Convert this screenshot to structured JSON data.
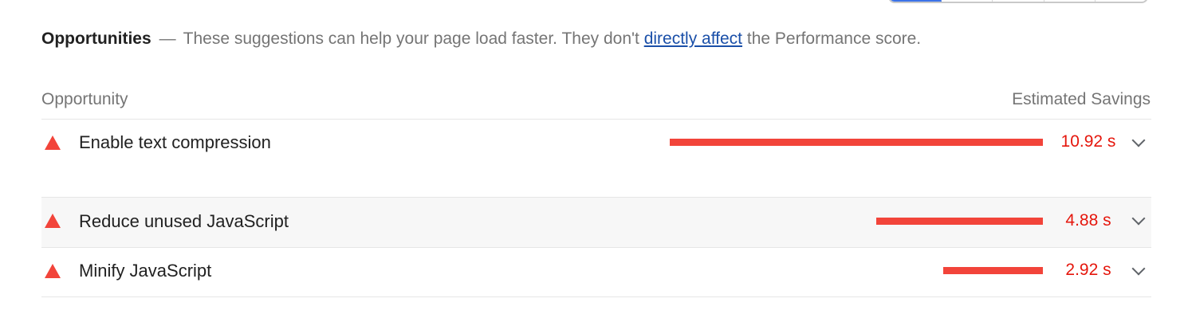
{
  "header": {
    "title": "Opportunities",
    "dash": "—",
    "description_before": "These suggestions can help your page load faster. They don't",
    "link_text": "directly affect",
    "description_after": "the Performance score."
  },
  "table": {
    "column_left": "Opportunity",
    "column_right": "Estimated Savings",
    "rows": [
      {
        "icon": "fail-triangle-icon",
        "title": "Enable text compression",
        "savings": "10.92 s",
        "savings_seconds": 10.92
      },
      {
        "icon": "fail-triangle-icon",
        "title": "Reduce unused JavaScript",
        "savings": "4.88 s",
        "savings_seconds": 4.88
      },
      {
        "icon": "fail-triangle-icon",
        "title": "Minify JavaScript",
        "savings": "2.92 s",
        "savings_seconds": 2.92
      }
    ]
  },
  "colors": {
    "fail": "#f2443a",
    "savings_text": "#e5160c",
    "link": "#1a4fa8",
    "muted_text": "#757575",
    "tab_active": "#3b73e8"
  }
}
